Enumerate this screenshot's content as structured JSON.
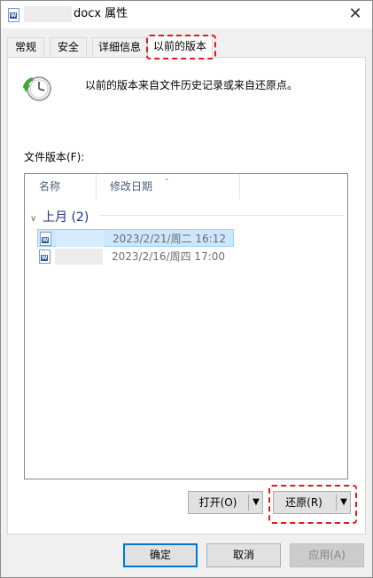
{
  "titlebar": {
    "title": "docx 属性",
    "close_glyph": "✕"
  },
  "tabs": [
    {
      "label": "常规"
    },
    {
      "label": "安全"
    },
    {
      "label": "详细信息"
    },
    {
      "label": "以前的版本"
    }
  ],
  "panel": {
    "info_text": "以前的版本来自文件历史记录或来自还原点。",
    "list_label": "文件版本(F):",
    "columns": [
      {
        "label": "名称"
      },
      {
        "label": "修改日期"
      }
    ],
    "group": {
      "label": "上月 (2)"
    },
    "files": [
      {
        "date": "2023/2/21/周二 16:12",
        "selected": true
      },
      {
        "date": "2023/2/16/周四 17:00",
        "selected": false
      }
    ],
    "open_button": "打开(O)",
    "restore_button": "还原(R)"
  },
  "footer": {
    "ok": "确定",
    "cancel": "取消",
    "apply": "应用(A)"
  },
  "colors": {
    "highlight": "#e31919",
    "selection": "#cce8ff",
    "accent": "#0078d7"
  }
}
